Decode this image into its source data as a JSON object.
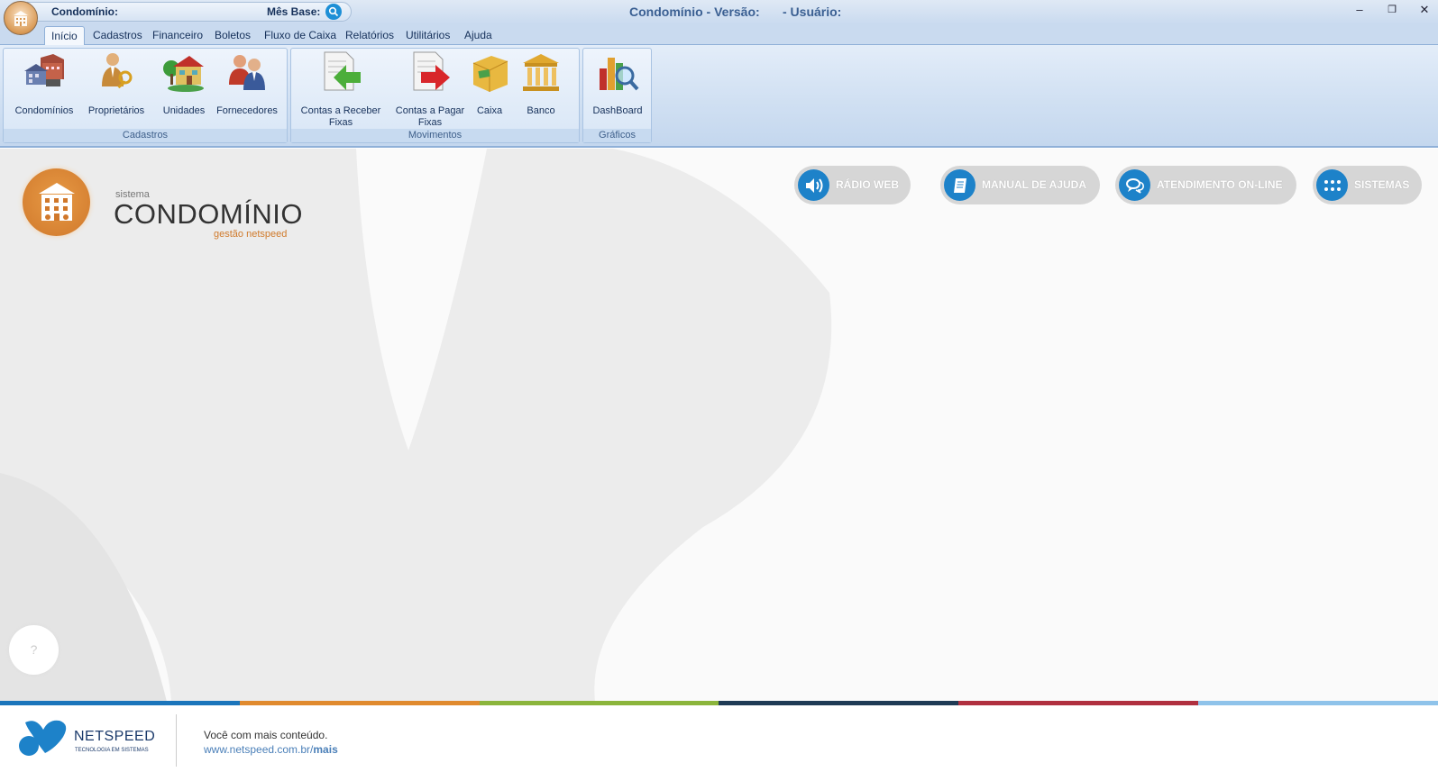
{
  "titlebar": {
    "condominio_label": "Condomínio:",
    "mes_base_label": "Mês Base:",
    "title": "Condomínio - Versão:",
    "user": "- Usuário:",
    "minimize": "–",
    "restore": "❐",
    "close": "✕"
  },
  "tabs": [
    "Início",
    "Cadastros",
    "Financeiro",
    "Boletos",
    "Fluxo de Caixa",
    "Relatórios",
    "Utilitários",
    "Ajuda"
  ],
  "ribbon": {
    "groups": [
      {
        "label": "Cadastros",
        "items": [
          "Condomínios",
          "Proprietários",
          "Unidades",
          "Fornecedores"
        ]
      },
      {
        "label": "Movimentos",
        "items": [
          "Contas a Receber\nFixas",
          "Contas a Pagar\nFixas",
          "Caixa",
          "Banco"
        ]
      },
      {
        "label": "Gráficos",
        "items": [
          "DashBoard"
        ]
      }
    ]
  },
  "logo": {
    "small": "sistema",
    "big": "CONDOMÍNIO",
    "sub": "gestão netspeed"
  },
  "pills": [
    {
      "label": "RÁDIO WEB",
      "icon": "speaker-icon"
    },
    {
      "label": "MANUAL DE AJUDA",
      "icon": "book-icon"
    },
    {
      "label": "ATENDIMENTO ON-LINE",
      "icon": "chat-icon"
    },
    {
      "label": "SISTEMAS",
      "icon": "grid-icon"
    }
  ],
  "help": "?",
  "colors": {
    "bar": [
      "#1b75bb",
      "#e08a2e",
      "#8bb53c",
      "#1f3b55",
      "#b0303f",
      "#8fc3ea"
    ],
    "accent": "#1d82c9"
  },
  "footer": {
    "brand": "NETSPEED",
    "tagline": "TECNOLOGIA EM SISTEMAS",
    "line1": "Você com mais conteúdo.",
    "link_prefix": "www.netspeed.com.br/",
    "link_bold": "mais"
  }
}
